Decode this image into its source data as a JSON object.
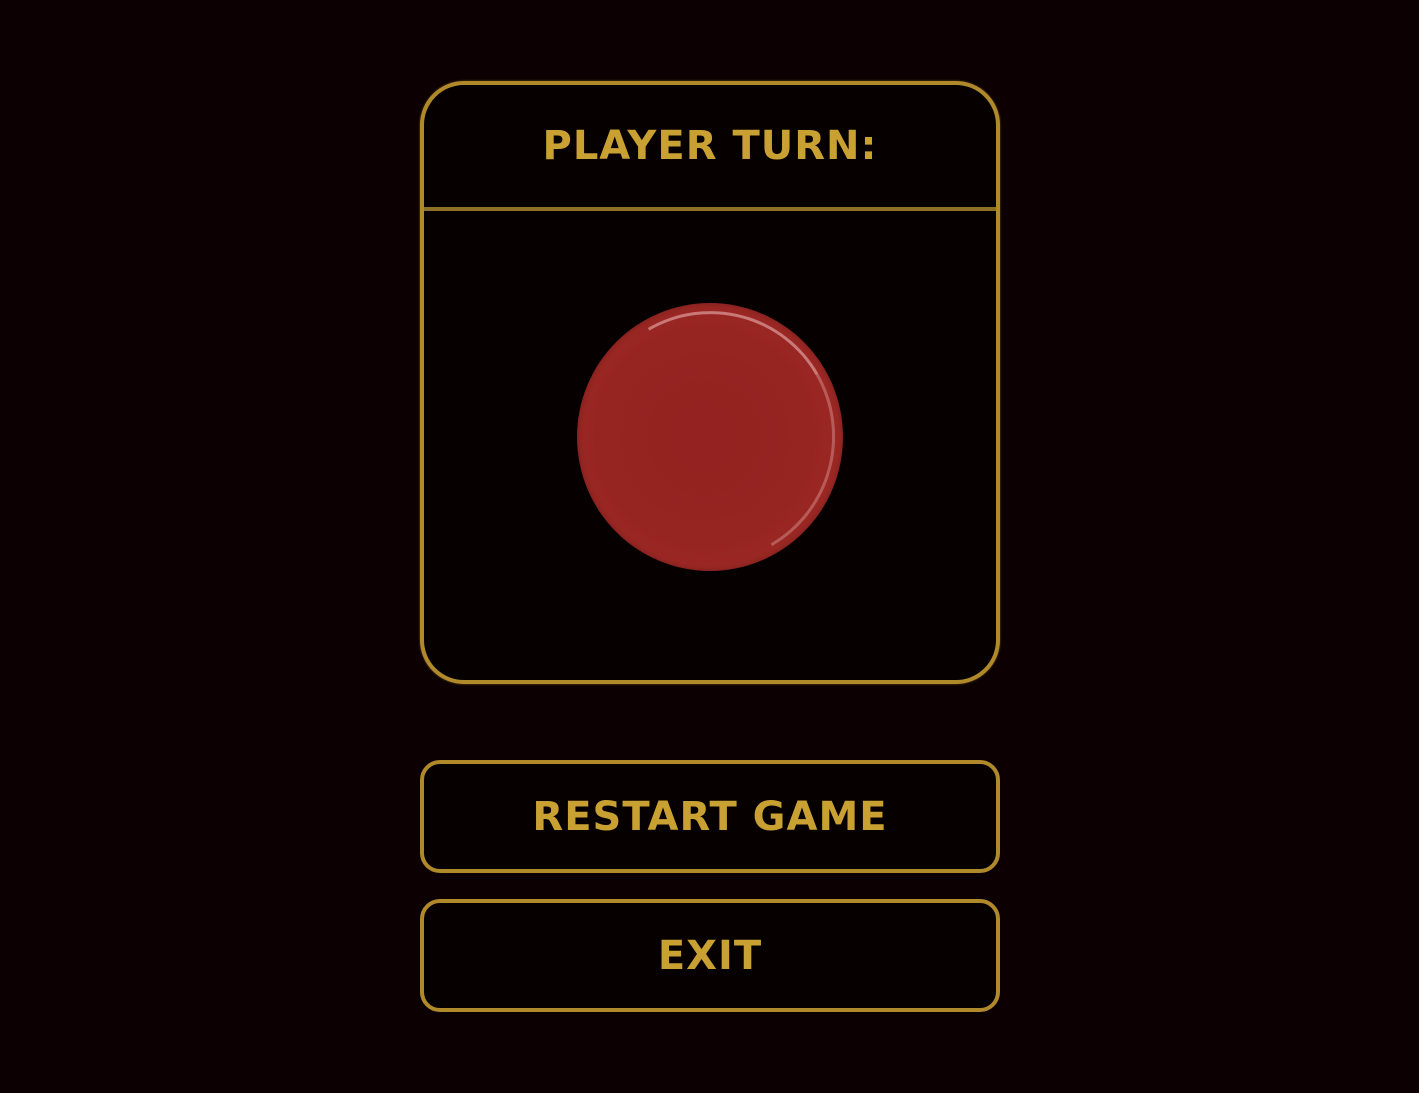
{
  "turn_panel": {
    "title": "PLAYER TURN:",
    "current_player_piece": "red-disc"
  },
  "buttons": {
    "restart_label": "RESTART GAME",
    "exit_label": "EXIT"
  },
  "colors": {
    "background": "#0d0002",
    "accent_gold": "#c9a032",
    "border_gold": "#b08a2a",
    "piece_red": "#962421"
  }
}
